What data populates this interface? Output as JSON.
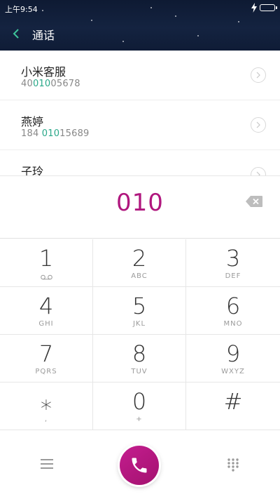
{
  "status_bar": {
    "time": "上午9:54"
  },
  "header": {
    "title": "通话"
  },
  "results": [
    {
      "name": "小米客服",
      "number_parts": [
        "40",
        "010",
        "05678"
      ]
    },
    {
      "name": "燕婷",
      "number_parts": [
        "184 ",
        "010",
        "15689"
      ]
    },
    {
      "name": "子玲",
      "number_parts": [
        "",
        "",
        ""
      ]
    }
  ],
  "dialer": {
    "input": "010"
  },
  "keypad": [
    {
      "digit": "1",
      "letters": ""
    },
    {
      "digit": "2",
      "letters": "ABC"
    },
    {
      "digit": "3",
      "letters": "DEF"
    },
    {
      "digit": "4",
      "letters": "GHI"
    },
    {
      "digit": "5",
      "letters": "JKL"
    },
    {
      "digit": "6",
      "letters": "MNO"
    },
    {
      "digit": "7",
      "letters": "PQRS"
    },
    {
      "digit": "8",
      "letters": "TUV"
    },
    {
      "digit": "9",
      "letters": "WXYZ"
    },
    {
      "digit": "⁎",
      "letters": ","
    },
    {
      "digit": "0",
      "letters": "+"
    },
    {
      "digit": "#",
      "letters": ""
    }
  ],
  "colors": {
    "accent": "#b0177e",
    "highlight": "#2aa889",
    "call_button": "#b8197f"
  }
}
